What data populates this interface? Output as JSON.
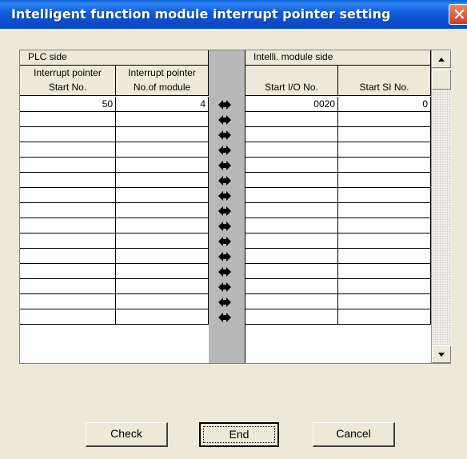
{
  "window": {
    "title": "Intelligent function module interrupt pointer setting"
  },
  "table": {
    "group_headers": {
      "plc_side": "PLC side",
      "module_side": "Intelli. module side"
    },
    "columns": [
      {
        "line1": "Interrupt pointer",
        "line2": "Start No."
      },
      {
        "line1": "Interrupt pointer",
        "line2": "No.of module"
      },
      {
        "line1": "",
        "line2": "Start I/O No."
      },
      {
        "line1": "",
        "line2": "Start SI No."
      }
    ],
    "rows": [
      [
        "50",
        "4",
        "0020",
        "0"
      ],
      [
        "",
        "",
        "",
        ""
      ],
      [
        "",
        "",
        "",
        ""
      ],
      [
        "",
        "",
        "",
        ""
      ],
      [
        "",
        "",
        "",
        ""
      ],
      [
        "",
        "",
        "",
        ""
      ],
      [
        "",
        "",
        "",
        ""
      ],
      [
        "",
        "",
        "",
        ""
      ],
      [
        "",
        "",
        "",
        ""
      ],
      [
        "",
        "",
        "",
        ""
      ],
      [
        "",
        "",
        "",
        ""
      ],
      [
        "",
        "",
        "",
        ""
      ],
      [
        "",
        "",
        "",
        ""
      ],
      [
        "",
        "",
        "",
        ""
      ],
      [
        "",
        "",
        "",
        ""
      ]
    ]
  },
  "buttons": {
    "check": "Check",
    "end": "End",
    "cancel": "Cancel"
  },
  "icons": {
    "close": "close-icon",
    "arrow": "bidirectional-arrow-icon",
    "scroll_up": "scroll-up-arrow-icon",
    "scroll_down": "scroll-down-arrow-icon"
  }
}
